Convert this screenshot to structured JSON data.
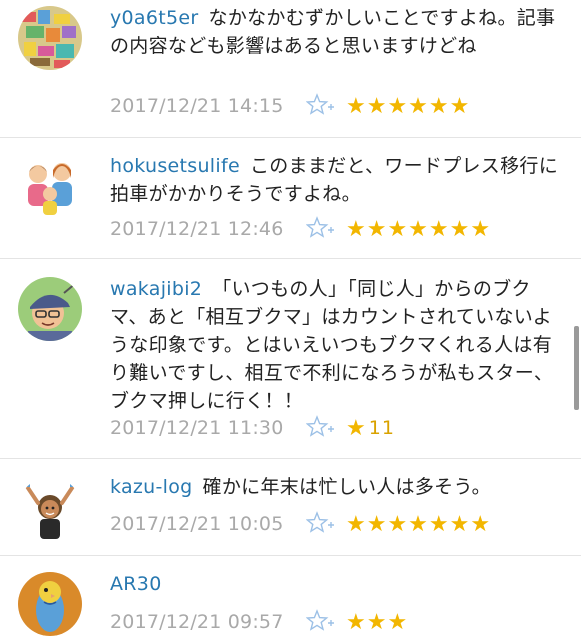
{
  "comments": [
    {
      "username": "y0a6t5er",
      "text": "なかなかむずかしいことですよね。記事の内容なども影響はあると思いますけどね",
      "timestamp": "2017/12/21 14:15",
      "stars": "★★★★★★",
      "star_count": "",
      "avatar_icon": "mosaic-avatar-icon"
    },
    {
      "username": "hokusetsulife",
      "text": "このままだと、ワードプレス移行に拍車がかかりそうですよね。",
      "timestamp": "2017/12/21 12:46",
      "stars": "★★★★★★★",
      "star_count": "",
      "avatar_icon": "family-avatar-icon"
    },
    {
      "username": "wakajibi2",
      "text": "「いつもの人」「同じ人」からのブクマ、あと「相互ブクマ」はカウントされていないような印象です。とはいえいつもブクマくれる人は有り難いですし、相互で不利になろうが私もスター、ブクマ押しに行く！！",
      "timestamp": "2017/12/21 11:30",
      "stars": "★",
      "star_count": "11",
      "avatar_icon": "man-with-cap-avatar-icon"
    },
    {
      "username": "kazu-log",
      "text": "確かに年末は忙しい人は多そう。",
      "timestamp": "2017/12/21 10:05",
      "stars": "★★★★★★★",
      "star_count": "",
      "avatar_icon": "cheering-person-avatar-icon"
    },
    {
      "username": "AR30",
      "text": "",
      "timestamp": "2017/12/21 09:57",
      "stars": "★★★",
      "star_count": "",
      "avatar_icon": "parakeet-avatar-icon"
    }
  ],
  "colors": {
    "username": "#2878b0",
    "timestamp": "#a9a9a9",
    "star": "#f2b600",
    "star_add_icon": "#9cc0e6",
    "divider": "#e4e4e4"
  }
}
